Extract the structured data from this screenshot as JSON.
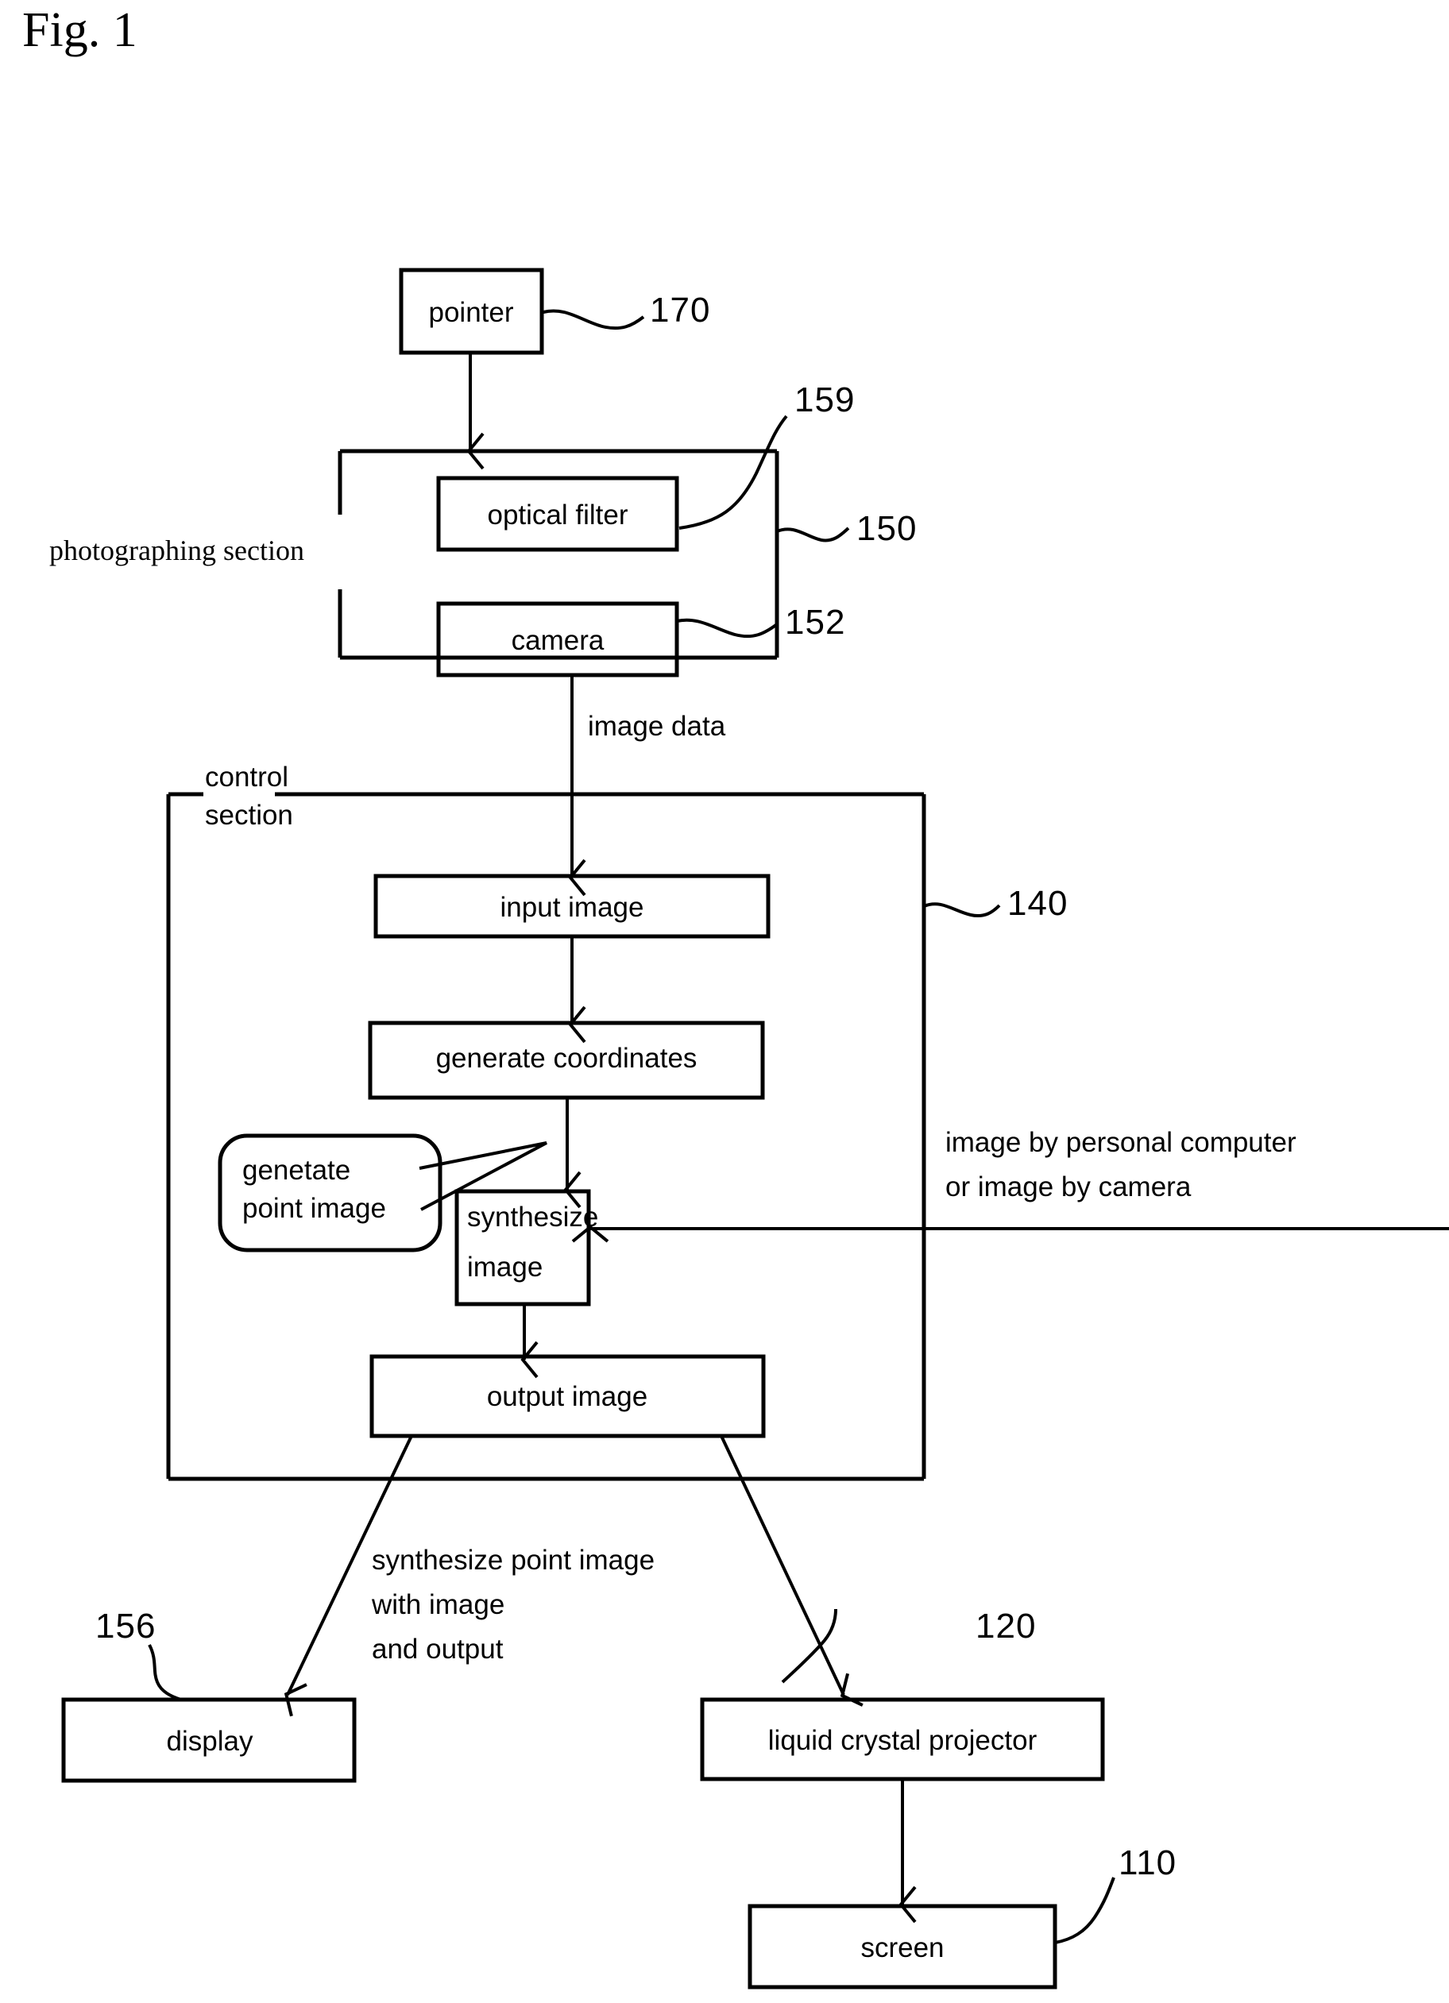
{
  "figure": {
    "title": "Fig. 1"
  },
  "boxes": {
    "pointer": "pointer",
    "optical_filter": "optical filter",
    "camera": "camera",
    "input_image": "input image",
    "generate_coordinates": "generate coordinates",
    "synthesize_image_line1": "synthesize",
    "synthesize_image_line2": "image",
    "output_image": "output image",
    "display": "display",
    "liquid_crystal_projector": "liquid crystal projector",
    "screen": "screen"
  },
  "callout": {
    "line1": "genetate",
    "line2": "point image"
  },
  "section_labels": {
    "photographing_section": "photographing section",
    "control_section_line1": "control",
    "control_section_line2": "section"
  },
  "flow_labels": {
    "image_data": "image data",
    "external_source_line1": "image by personal computer",
    "external_source_line2": "or image by camera",
    "output_note_line1": "synthesize point image",
    "output_note_line2": "with image",
    "output_note_line3": "and output"
  },
  "reference_numerals": {
    "pointer": "170",
    "optical_filter": "159",
    "photographing_section": "150",
    "camera": "152",
    "control_section": "140",
    "display": "156",
    "liquid_crystal_projector": "120",
    "screen": "110"
  },
  "colors": {
    "ink": "#000000",
    "paper": "#ffffff"
  }
}
